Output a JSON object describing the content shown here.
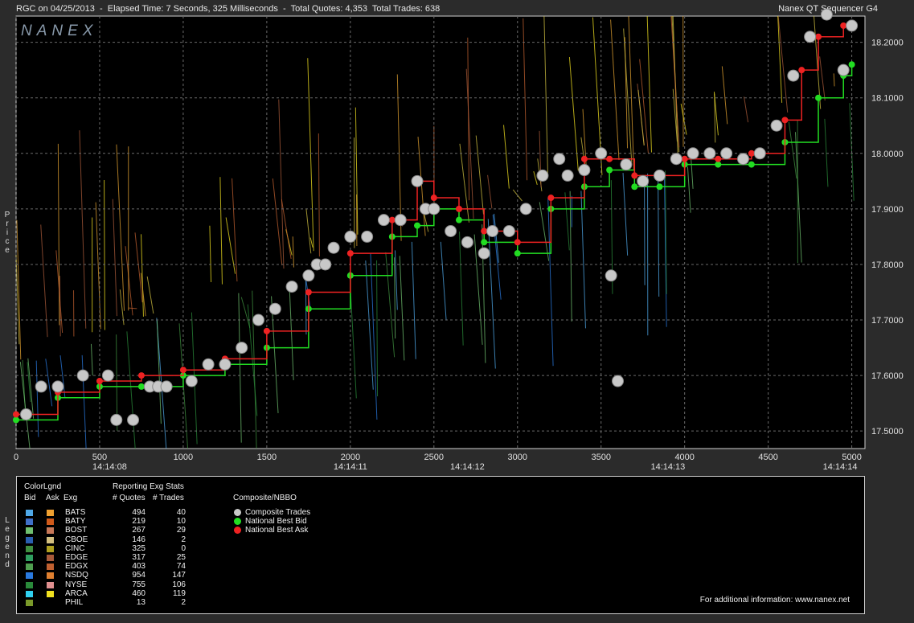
{
  "header": {
    "left": "RGC on 04/25/2013  -  Elapsed Time: 7 Seconds, 325 Milliseconds  -  Total Quotes: 4,353  Total Trades: 638",
    "right": "Nanex QT Sequencer G4",
    "logo": "NANEX"
  },
  "side_labels": {
    "price": "Price",
    "legend": "Legend"
  },
  "chart_data": {
    "type": "line",
    "title": "",
    "ylabel": "Price",
    "xlabel": "",
    "xlim": [
      0,
      5050
    ],
    "ylim": [
      17.48,
      18.24
    ],
    "x_ticks": [
      0,
      500,
      1000,
      1500,
      2000,
      2500,
      3000,
      3500,
      4000,
      4500,
      5000
    ],
    "x_tick_labels": [
      "0",
      "500",
      "1000",
      "1500",
      "2000",
      "2500",
      "3000",
      "3500",
      "4000",
      "4500",
      "5000"
    ],
    "y_ticks": [
      17.5,
      17.6,
      17.7,
      17.8,
      17.9,
      18.0,
      18.1,
      18.2
    ],
    "y_tick_labels": [
      "17.5000",
      "17.6000",
      "17.7000",
      "17.8000",
      "17.9000",
      "18.0000",
      "18.1000",
      "18.2000"
    ],
    "time_labels": [
      {
        "x": 560,
        "label": "14:14:08"
      },
      {
        "x": 2000,
        "label": "14:14:11"
      },
      {
        "x": 2700,
        "label": "14:14:12"
      },
      {
        "x": 3900,
        "label": "14:14:13"
      },
      {
        "x": 4930,
        "label": "14:14:14"
      }
    ],
    "grid": true,
    "series": [
      {
        "name": "National Best Bid",
        "color": "#22dd22",
        "x": [
          0,
          250,
          500,
          750,
          1000,
          1250,
          1500,
          1750,
          2000,
          2250,
          2400,
          2500,
          2650,
          2800,
          3000,
          3200,
          3400,
          3550,
          3700,
          3850,
          4000,
          4200,
          4400,
          4600,
          4800,
          4950,
          5000
        ],
        "y": [
          17.52,
          17.56,
          17.58,
          17.58,
          17.6,
          17.62,
          17.65,
          17.72,
          17.78,
          17.85,
          17.87,
          17.9,
          17.88,
          17.84,
          17.82,
          17.9,
          17.94,
          17.97,
          17.94,
          17.94,
          17.98,
          17.98,
          17.98,
          18.02,
          18.1,
          18.14,
          18.16
        ]
      },
      {
        "name": "National Best Ask",
        "color": "#ee2222",
        "x": [
          0,
          250,
          500,
          750,
          1000,
          1250,
          1500,
          1750,
          2000,
          2250,
          2400,
          2500,
          2650,
          2800,
          3000,
          3200,
          3400,
          3550,
          3700,
          3850,
          4000,
          4200,
          4400,
          4600,
          4700,
          4800,
          4950,
          5000
        ],
        "y": [
          17.53,
          17.57,
          17.59,
          17.6,
          17.61,
          17.63,
          17.68,
          17.75,
          17.82,
          17.88,
          17.95,
          17.92,
          17.9,
          17.86,
          17.84,
          17.92,
          17.99,
          17.99,
          17.96,
          17.96,
          17.99,
          17.99,
          18.0,
          18.06,
          18.15,
          18.21,
          18.23,
          18.23
        ]
      },
      {
        "name": "Composite Trades",
        "color": "#c8c8c8",
        "x": [
          60,
          150,
          250,
          400,
          550,
          600,
          700,
          800,
          850,
          900,
          1050,
          1150,
          1250,
          1350,
          1450,
          1550,
          1650,
          1750,
          1800,
          1850,
          1900,
          2000,
          2100,
          2200,
          2300,
          2400,
          2450,
          2500,
          2600,
          2700,
          2800,
          2850,
          2950,
          3050,
          3150,
          3250,
          3300,
          3400,
          3500,
          3560,
          3600,
          3650,
          3750,
          3850,
          3950,
          4050,
          4150,
          4250,
          4350,
          4450,
          4550,
          4650,
          4750,
          4850,
          4950,
          5000
        ],
        "y": [
          17.53,
          17.58,
          17.58,
          17.6,
          17.6,
          17.52,
          17.52,
          17.58,
          17.58,
          17.58,
          17.59,
          17.62,
          17.62,
          17.65,
          17.7,
          17.72,
          17.76,
          17.78,
          17.8,
          17.8,
          17.83,
          17.85,
          17.85,
          17.88,
          17.88,
          17.95,
          17.9,
          17.9,
          17.86,
          17.84,
          17.82,
          17.86,
          17.86,
          17.9,
          17.96,
          17.99,
          17.96,
          17.97,
          18.0,
          17.78,
          17.59,
          17.98,
          17.95,
          17.96,
          17.99,
          18.0,
          18.0,
          18.0,
          17.99,
          18.0,
          18.05,
          18.14,
          18.21,
          18.25,
          18.15,
          18.23
        ]
      }
    ]
  },
  "legend": {
    "col_headers": {
      "colorlgnd": "ColorLgnd",
      "bid": "Bid",
      "ask": "Ask",
      "exg": "Exg"
    },
    "stats_header": "Reporting Exg Stats",
    "quotes_header": "# Quotes",
    "trades_header": "# Trades",
    "composite_header": "Composite/NBBO",
    "exchanges": [
      {
        "name": "BATS",
        "quotes": "494",
        "trades": "40",
        "bid_color": "#4fa8e8",
        "ask_color": "#f0a030"
      },
      {
        "name": "BATY",
        "quotes": "219",
        "trades": "10",
        "bid_color": "#3f6fc8",
        "ask_color": "#d05a1a"
      },
      {
        "name": "BOST",
        "quotes": "267",
        "trades": "29",
        "bid_color": "#6fbf6f",
        "ask_color": "#c87858"
      },
      {
        "name": "CBOE",
        "quotes": "146",
        "trades": "2",
        "bid_color": "#2a5fb0",
        "ask_color": "#d4c080"
      },
      {
        "name": "CINC",
        "quotes": "325",
        "trades": "0",
        "bid_color": "#3f8f3f",
        "ask_color": "#b0a020"
      },
      {
        "name": "EDGE",
        "quotes": "317",
        "trades": "25",
        "bid_color": "#2f9f5f",
        "ask_color": "#a85a3a"
      },
      {
        "name": "EDGX",
        "quotes": "403",
        "trades": "74",
        "bid_color": "#4f9f4f",
        "ask_color": "#c06030"
      },
      {
        "name": "NSDQ",
        "quotes": "954",
        "trades": "147",
        "bid_color": "#2a7ae0",
        "ask_color": "#e08030"
      },
      {
        "name": "NYSE",
        "quotes": "755",
        "trades": "106",
        "bid_color": "#2a8a3a",
        "ask_color": "#e09090"
      },
      {
        "name": "ARCA",
        "quotes": "460",
        "trades": "119",
        "bid_color": "#30d0f0",
        "ask_color": "#f0e020"
      },
      {
        "name": "PHIL",
        "quotes": "13",
        "trades": "2",
        "bid_color": "#7a9a2a",
        "ask_color": ""
      }
    ],
    "composite": [
      {
        "label": "Composite Trades",
        "color": "#c8c8c8"
      },
      {
        "label": "National Best Bid",
        "color": "#22dd22"
      },
      {
        "label": "National Best Ask",
        "color": "#ee2222"
      }
    ],
    "footer": "For additional information: www.nanex.net"
  }
}
